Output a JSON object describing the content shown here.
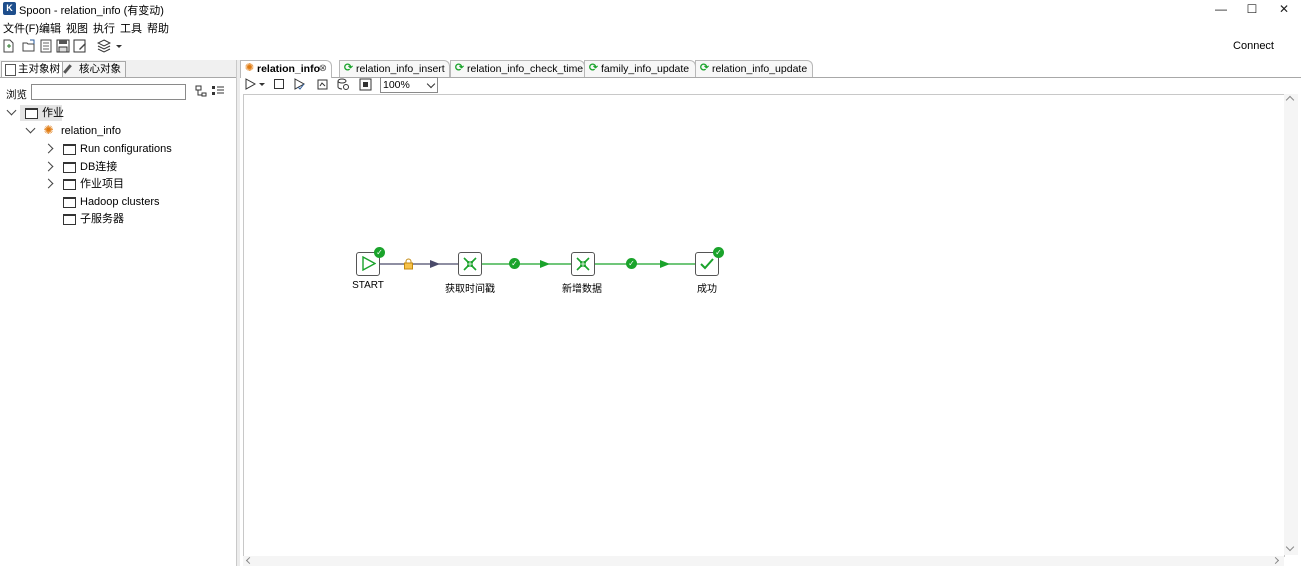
{
  "window": {
    "title": "Spoon - relation_info (有变动)",
    "app_icon": "spoon-icon",
    "controls": [
      "minimize-icon",
      "maximize-icon",
      "close-icon"
    ]
  },
  "menu": [
    "文件(F)",
    "编辑",
    "视图",
    "执行",
    "工具",
    "帮助"
  ],
  "toolbar": {
    "icons": [
      "new-file-icon",
      "open-icon",
      "explore-icon",
      "save-icon",
      "save-as-icon",
      "layers-icon"
    ],
    "connect_label": "Connect"
  },
  "left_panel": {
    "tabs": [
      "主对象树",
      "核心对象"
    ],
    "browse_label": "浏览",
    "search_value": "",
    "tree": {
      "root": "作业",
      "job": "relation_info",
      "children": [
        "Run configurations",
        "DB连接",
        "作业项目",
        "Hadoop clusters",
        "子服务器"
      ]
    }
  },
  "editor_tabs": [
    {
      "label": "relation_info",
      "active": true,
      "icon": "job-icon"
    },
    {
      "label": "relation_info_insert",
      "active": false,
      "icon": "transformation-icon"
    },
    {
      "label": "relation_info_check_time",
      "active": false,
      "icon": "transformation-icon"
    },
    {
      "label": "family_info_update",
      "active": false,
      "icon": "transformation-icon"
    },
    {
      "label": "relation_info_update",
      "active": false,
      "icon": "transformation-icon"
    }
  ],
  "editor_toolbar": {
    "zoom": "100%"
  },
  "workflow": {
    "nodes": [
      {
        "label": "START",
        "icon": "start-icon",
        "status": "success"
      },
      {
        "label": "获取时间戳",
        "icon": "transformation-icon",
        "status": "none"
      },
      {
        "label": "新增数据",
        "icon": "transformation-icon",
        "status": "none"
      },
      {
        "label": "成功",
        "icon": "success-icon",
        "status": "success"
      }
    ],
    "hops": [
      {
        "type": "unconditional",
        "icon": "lock-icon",
        "color": "#4a4a6a"
      },
      {
        "type": "on-success",
        "icon": "check-icon",
        "color": "#1aa32b"
      },
      {
        "type": "on-success",
        "icon": "check-icon",
        "color": "#1aa32b"
      }
    ]
  },
  "colors": {
    "success": "#1aa32b",
    "job_icon": "#e07a10",
    "transformation_icon": "#1aa32b"
  }
}
